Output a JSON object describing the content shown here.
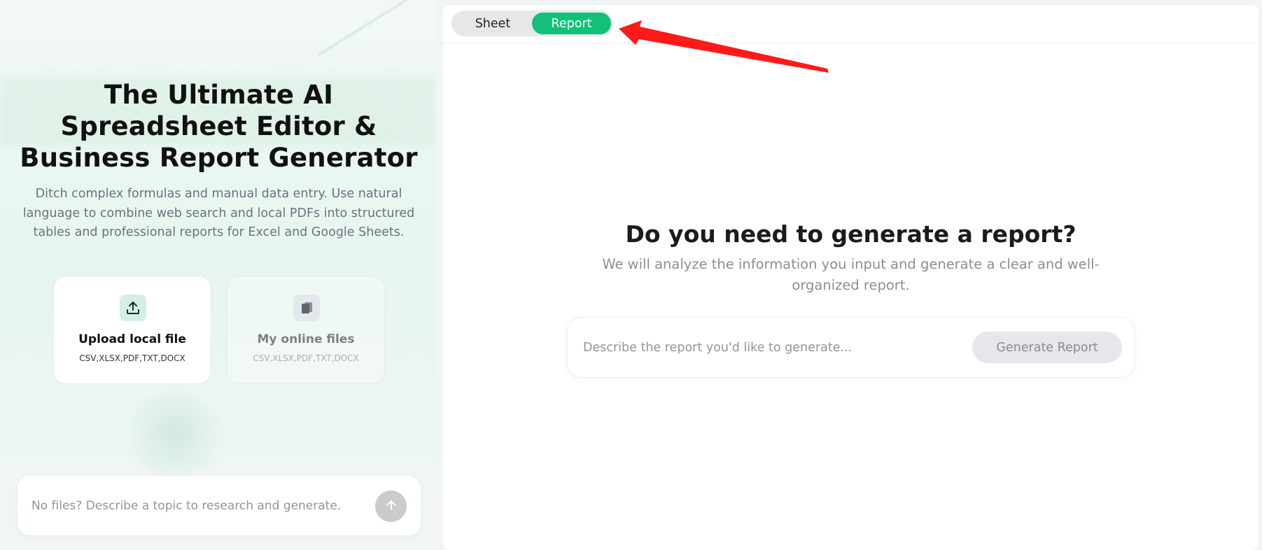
{
  "left": {
    "title": "The Ultimate AI Spreadsheet Editor & Business Report Generator",
    "subtitle": "Ditch complex formulas and manual data entry. Use natural language to combine web search and local PDFs into structured tables and professional reports for Excel and Google Sheets.",
    "cards": [
      {
        "icon": "upload-icon",
        "title": "Upload local file",
        "formats": "CSV,XLSX,PDF,TXT,DOCX"
      },
      {
        "icon": "folder-files-icon",
        "title": "My online files",
        "formats": "CSV,XLSX,PDF,TXT,DOCX"
      }
    ],
    "prompt": {
      "placeholder": "No files? Describe a topic to research and generate.",
      "send_icon": "arrow-up-icon"
    }
  },
  "right": {
    "toggle": {
      "sheet_label": "Sheet",
      "report_label": "Report",
      "active": "Report"
    },
    "heading": "Do you need to generate a report?",
    "description": "We will analyze the information you input and generate a clear and well-organized report.",
    "input": {
      "placeholder": "Describe the report you'd like to generate...",
      "button_label": "Generate Report"
    }
  },
  "annotation": {
    "icon": "red-arrow-icon",
    "color": "#ff1a1a"
  },
  "colors": {
    "accent": "#12c07a",
    "toggle_bg": "#e6e7e9",
    "button_disabled": "#e5e7eb"
  }
}
